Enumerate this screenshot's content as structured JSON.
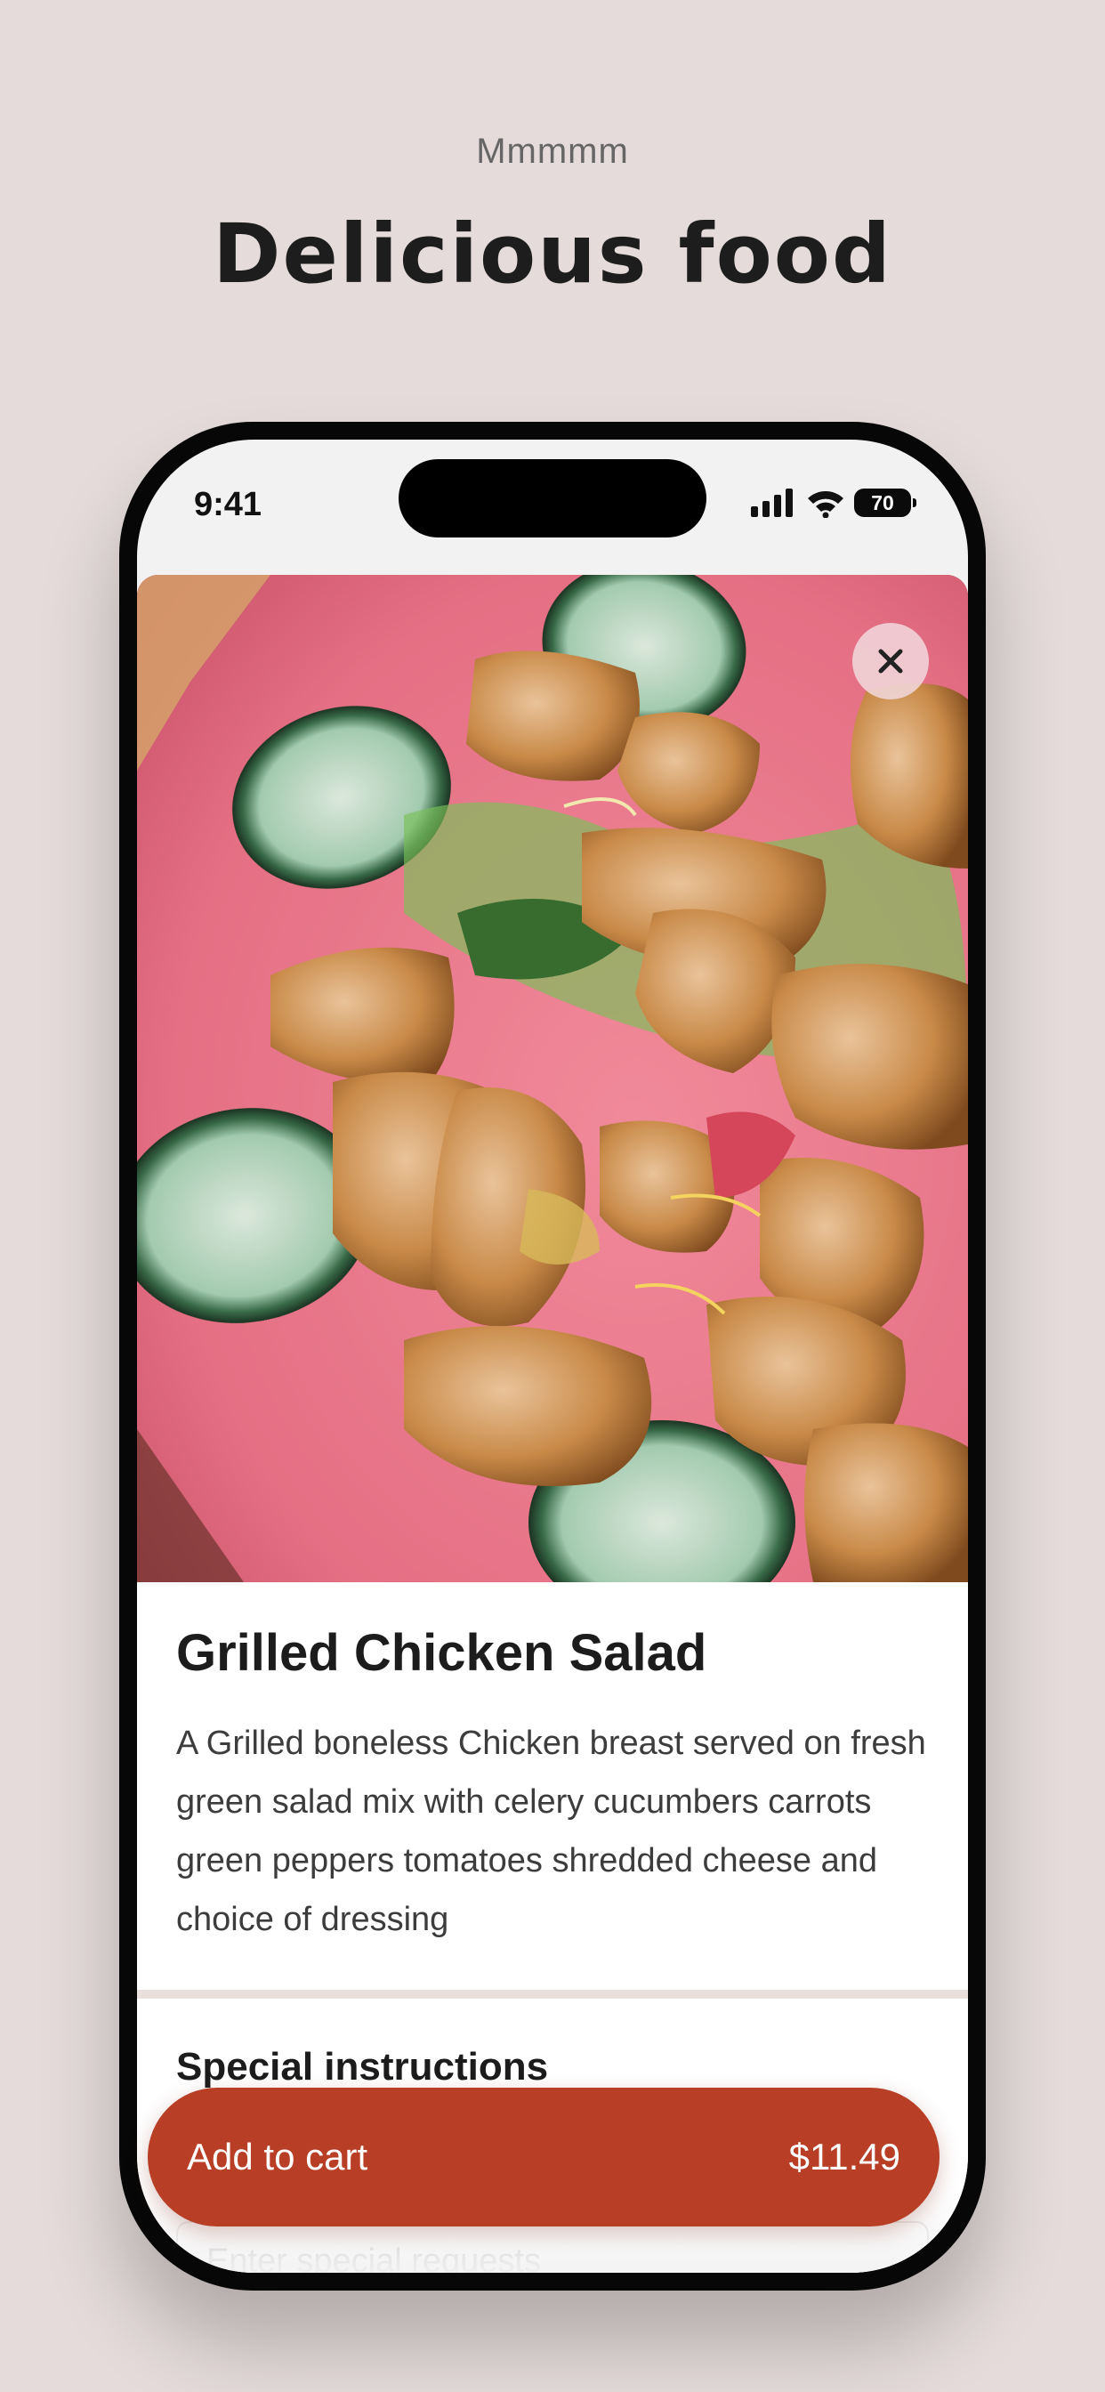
{
  "header": {
    "eyebrow": "Mmmmm",
    "headline": "Delicious food"
  },
  "status_bar": {
    "time": "9:41",
    "battery_level": "70",
    "icons": [
      "signal-icon",
      "wifi-icon",
      "battery-icon"
    ]
  },
  "item": {
    "image_alt": "Grilled chicken salad with cucumbers on a pink plate",
    "name": "Grilled Chicken Salad",
    "description": "A Grilled boneless Chicken breast served on fresh green salad mix with celery cucumbers carrots green peppers tomatoes shredded cheese and choice of dressing"
  },
  "special_instructions": {
    "label": "Special instructions",
    "placeholder": "Enter special requests"
  },
  "cart_button": {
    "label": "Add to cart",
    "price": "$11.49"
  },
  "colors": {
    "background": "#e4dbda",
    "accent": "#b83e25",
    "plate": "#e67c8e"
  }
}
